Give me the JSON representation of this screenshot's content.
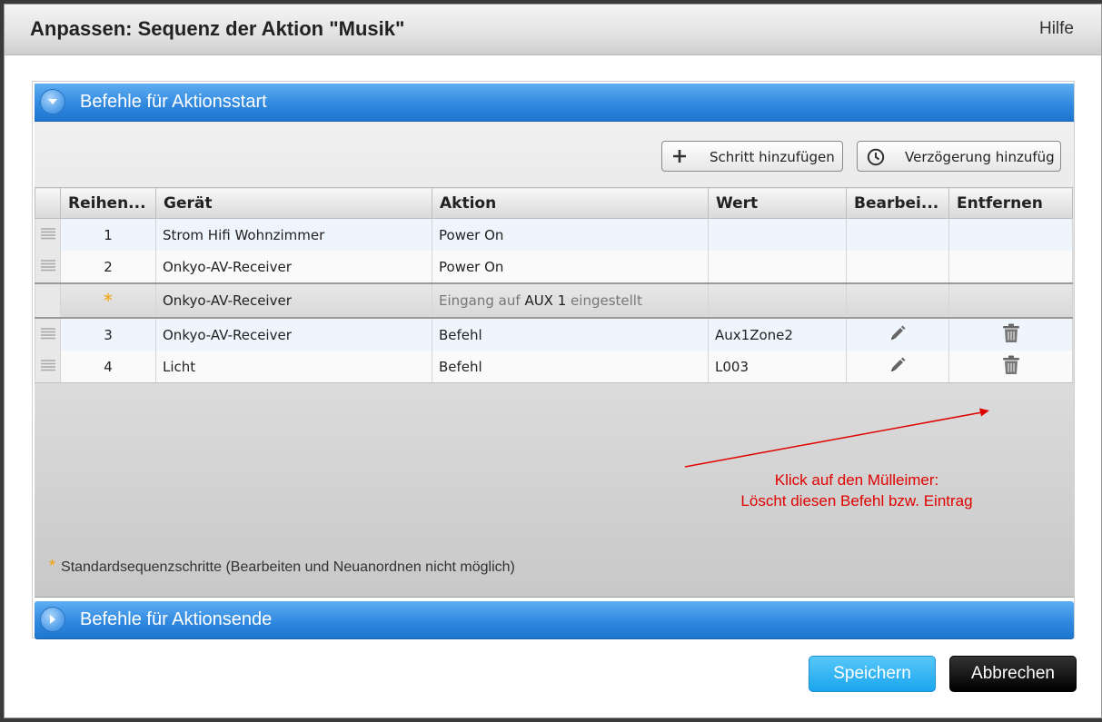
{
  "dialog": {
    "title": "Anpassen: Sequenz der Aktion \"Musik\"",
    "help_label": "Hilfe"
  },
  "sections": {
    "start": {
      "label": "Befehle für Aktionsstart",
      "icon": "chevron-down-icon"
    },
    "end": {
      "label": "Befehle für Aktionsende",
      "icon": "chevron-right-icon"
    }
  },
  "toolbar": {
    "add_step_label": "Schritt hinzufügen",
    "add_delay_label": "Verzögerung hinzufüg"
  },
  "table": {
    "columns": [
      "Reihen...",
      "Gerät",
      "Aktion",
      "Wert",
      "Bearbei...",
      "Entfernen"
    ],
    "rows": [
      {
        "order": "1",
        "device": "Strom Hifi Wohnzimmer",
        "action": "Power On",
        "value": ""
      },
      {
        "order": "2",
        "device": "Onkyo-AV-Receiver",
        "action": "Power On",
        "value": ""
      },
      {
        "order": "*",
        "device": "Onkyo-AV-Receiver",
        "action_prefix": "Eingang auf",
        "action_highlight": "AUX 1",
        "action_suffix": "eingestellt",
        "value": ""
      },
      {
        "order": "3",
        "device": "Onkyo-AV-Receiver",
        "action": "Befehl",
        "value": "Aux1Zone2"
      },
      {
        "order": "4",
        "device": "Licht",
        "action": "Befehl",
        "value": "L003"
      }
    ]
  },
  "annotation": {
    "line1": "Klick auf den Mülleimer:",
    "line2": "Löscht diesen Befehl bzw. Eintrag"
  },
  "footnote": {
    "star": "*",
    "text": "Standardsequenzschritte (Bearbeiten und Neuanordnen nicht möglich)"
  },
  "buttons": {
    "save": "Speichern",
    "cancel": "Abbrechen"
  },
  "colors": {
    "section_blue": "#2e86dd",
    "annotation_red": "#e00000",
    "star_orange": "#f4a100",
    "save_blue": "#1aa6ef"
  }
}
